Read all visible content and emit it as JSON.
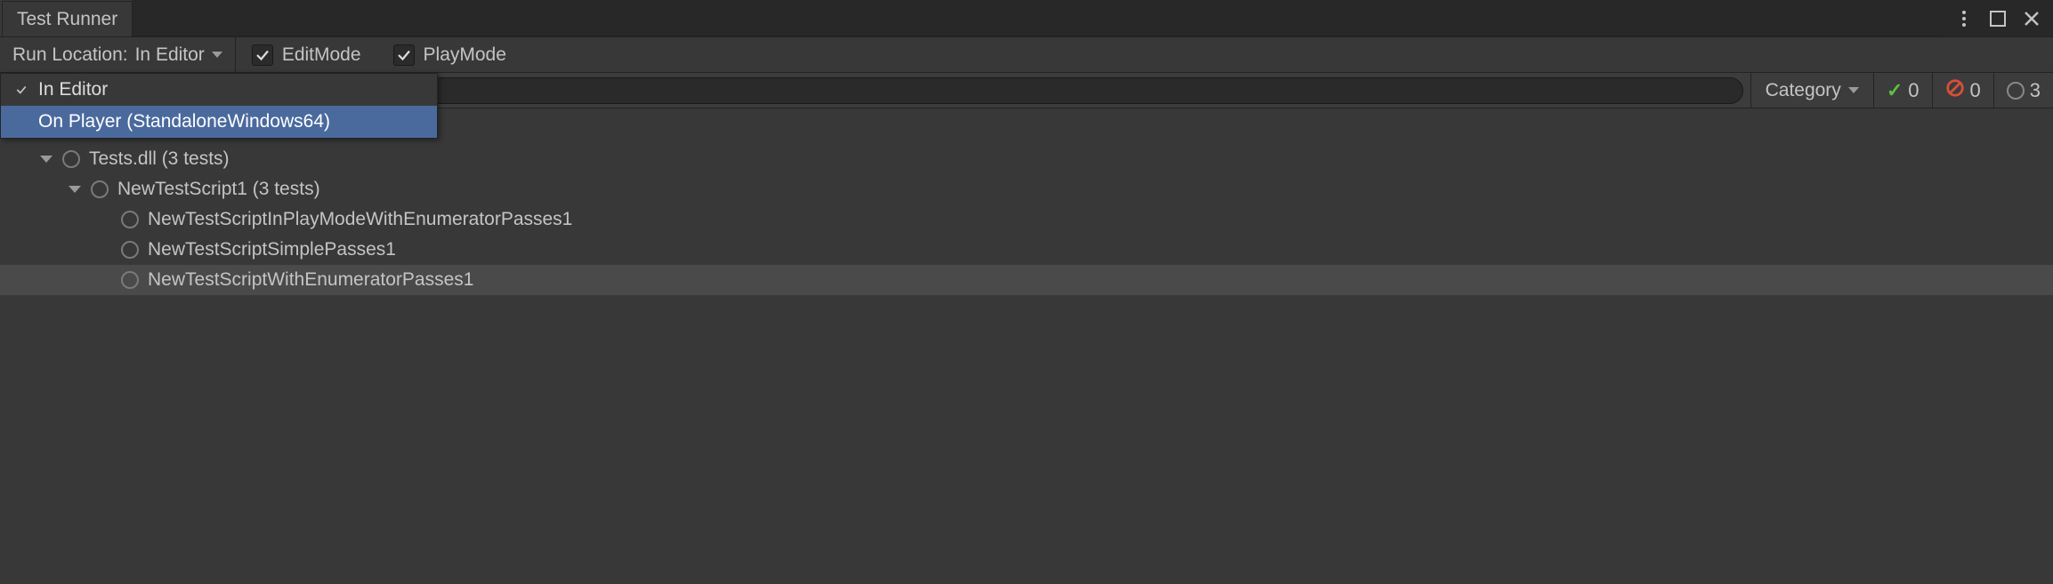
{
  "window": {
    "title": "Test Runner"
  },
  "toolbar": {
    "runLocation": {
      "label": "Run Location:",
      "value": "In Editor"
    },
    "editMode": {
      "label": "EditMode",
      "checked": true
    },
    "playMode": {
      "label": "PlayMode",
      "checked": true
    }
  },
  "dropdown": {
    "items": [
      {
        "label": "In Editor",
        "checked": true,
        "selected": false
      },
      {
        "label": "On Player (StandaloneWindows64)",
        "checked": false,
        "selected": true
      }
    ]
  },
  "filterBar": {
    "categoryLabel": "Category",
    "passCount": "0",
    "failCount": "0",
    "skipCount": "3"
  },
  "tree": [
    {
      "indent": 1,
      "foldout": true,
      "label": "Tests.dll (3 tests)",
      "highlighted": false
    },
    {
      "indent": 2,
      "foldout": true,
      "label": "NewTestScript1 (3 tests)",
      "highlighted": false
    },
    {
      "indent": 3,
      "foldout": false,
      "label": "NewTestScriptInPlayModeWithEnumeratorPasses1",
      "highlighted": false
    },
    {
      "indent": 3,
      "foldout": false,
      "label": "NewTestScriptSimplePasses1",
      "highlighted": false
    },
    {
      "indent": 3,
      "foldout": false,
      "label": "NewTestScriptWithEnumeratorPasses1",
      "highlighted": true
    }
  ]
}
